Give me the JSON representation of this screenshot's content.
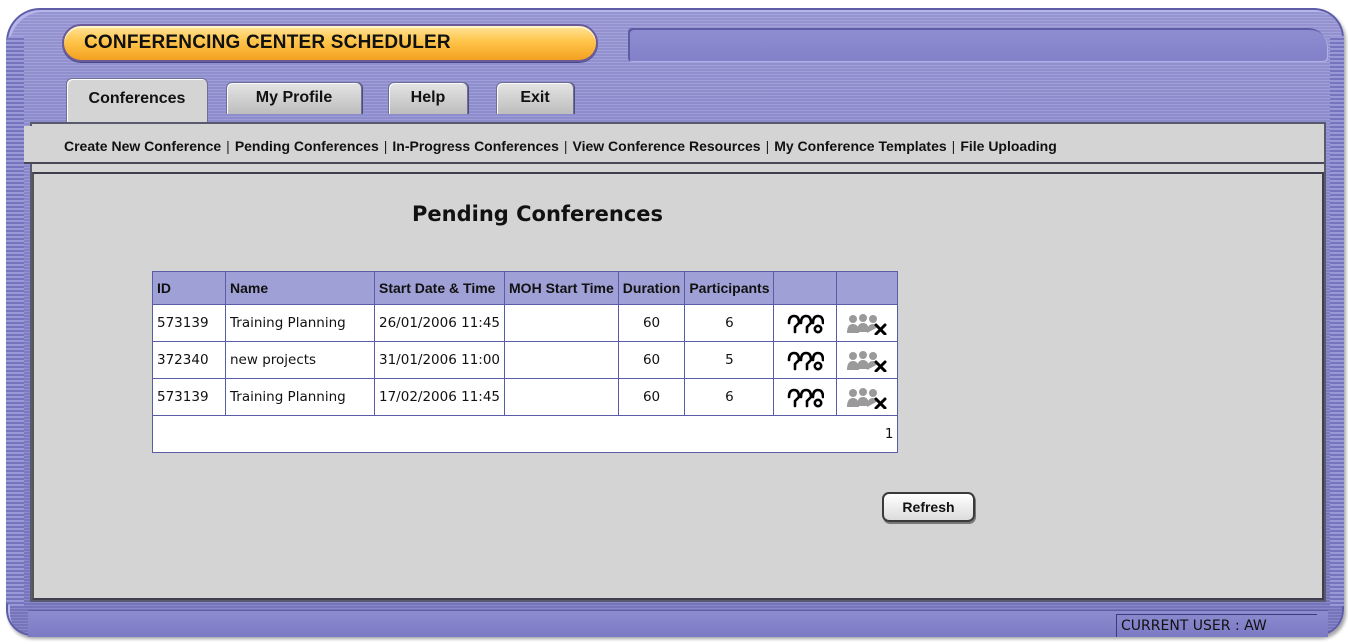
{
  "app": {
    "title": "CONFERENCING CENTER SCHEDULER"
  },
  "tabs": [
    {
      "label": "Conferences",
      "active": true
    },
    {
      "label": "My Profile",
      "active": false
    },
    {
      "label": "Help",
      "active": false
    },
    {
      "label": "Exit",
      "active": false
    }
  ],
  "subnav": [
    "Create New Conference",
    "Pending Conferences",
    "In-Progress Conferences",
    "View Conference Resources",
    "My Conference Templates",
    "File Uploading"
  ],
  "page_title": "Pending Conferences",
  "table": {
    "headers": [
      "ID",
      "Name",
      "Start Date & Time",
      "MOH Start Time",
      "Duration",
      "Participants",
      "",
      ""
    ],
    "rows": [
      {
        "id": "573139",
        "name": "Training Planning",
        "start": "26/01/2006 11:45",
        "moh": "",
        "duration": "60",
        "participants": "6"
      },
      {
        "id": "372340",
        "name": "new projects",
        "start": "31/01/2006 11:00",
        "moh": "",
        "duration": "60",
        "participants": "5"
      },
      {
        "id": "573139",
        "name": "Training Planning",
        "start": "17/02/2006 11:45",
        "moh": "",
        "duration": "60",
        "participants": "6"
      }
    ],
    "row_icons": [
      "participants-icon",
      "remove-participants-icon"
    ],
    "page_number": "1"
  },
  "refresh_label": "Refresh",
  "status": {
    "current_user": "CURRENT USER : AW"
  },
  "colors": {
    "frame": "#8584cc",
    "title_pill": "#ffc54a",
    "panel": "#d4d4d4",
    "table_header": "#9fa0d6"
  }
}
